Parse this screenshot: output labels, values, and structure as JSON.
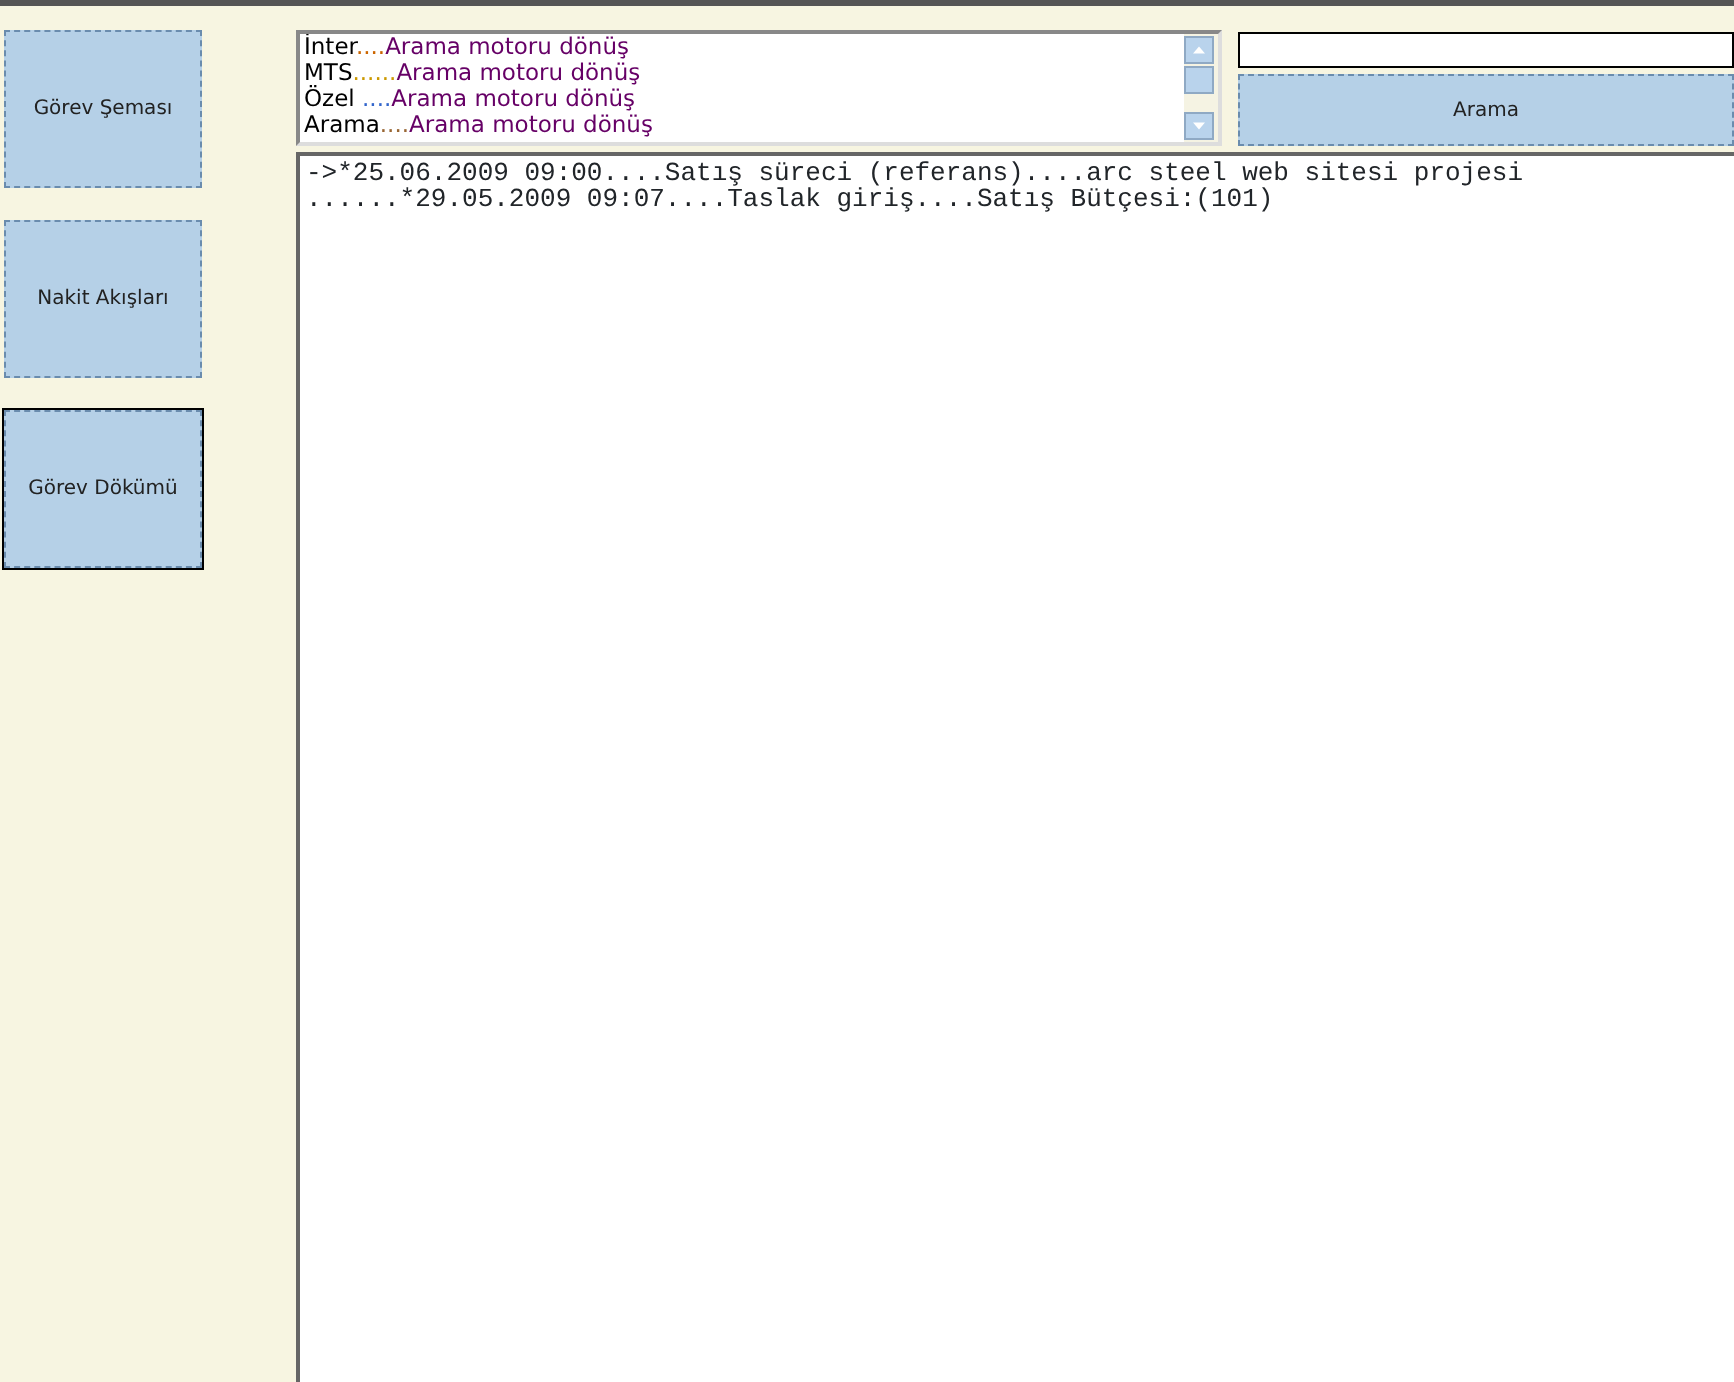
{
  "sidebar": {
    "buttons": [
      {
        "label": "Görev Şeması",
        "selected": false
      },
      {
        "label": "Nakit Akışları",
        "selected": false
      },
      {
        "label": "Görev Dökümü",
        "selected": true
      }
    ]
  },
  "results_list": {
    "items": [
      {
        "source": "İnter",
        "dots": "....",
        "text": "Arama motoru dönüş",
        "color": "#cc6600"
      },
      {
        "source": "MTS",
        "dots": "......",
        "text": "Arama motoru dönüş",
        "color": "#cc9900"
      },
      {
        "source": "Özel ",
        "dots": "....",
        "text": "Arama motoru dönüş",
        "color": "#3366cc"
      },
      {
        "source": "Arama",
        "dots": "....",
        "text": "Arama motoru dönüş",
        "color": "#996633"
      }
    ]
  },
  "search": {
    "button": "Arama"
  },
  "log": {
    "lines": [
      "->*25.06.2009 09:00....Satış süreci (referans)....arc steel web sitesi projesi",
      "......*29.05.2009 09:07....Taslak giriş....Satış Bütçesi:(101)"
    ]
  }
}
